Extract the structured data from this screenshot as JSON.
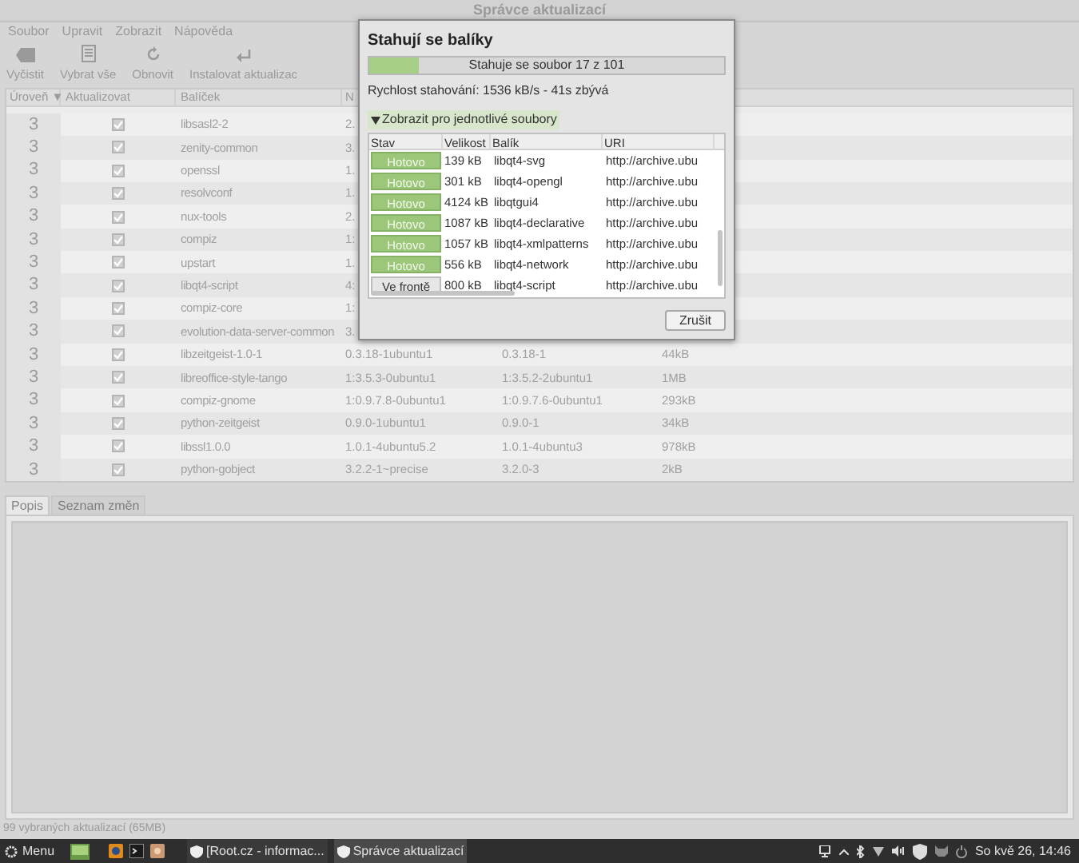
{
  "window": {
    "title": "Správce aktualizací"
  },
  "menu": [
    "Soubor",
    "Upravit",
    "Zobrazit",
    "Nápověda"
  ],
  "toolbar": [
    {
      "label": "Vyčistit",
      "kind": "clear"
    },
    {
      "label": "Vybrat vše",
      "kind": "select"
    },
    {
      "label": "Obnovit",
      "kind": "refresh"
    },
    {
      "label": "Instalovat aktualizac",
      "kind": "install"
    }
  ],
  "table": {
    "columns": [
      "Úroveň ▼",
      "Aktualizovat",
      "Balíček",
      "N"
    ],
    "rows": [
      {
        "level": "3",
        "checked": true,
        "package": "libsasl2-2",
        "new": "2."
      },
      {
        "level": "3",
        "checked": true,
        "package": "zenity-common",
        "new": "3."
      },
      {
        "level": "3",
        "checked": true,
        "package": "openssl",
        "new": "1."
      },
      {
        "level": "3",
        "checked": true,
        "package": "resolvconf",
        "new": "1."
      },
      {
        "level": "3",
        "checked": true,
        "package": "nux-tools",
        "new": "2."
      },
      {
        "level": "3",
        "checked": true,
        "package": "compiz",
        "new": "1:"
      },
      {
        "level": "3",
        "checked": true,
        "package": "upstart",
        "new": "1."
      },
      {
        "level": "3",
        "checked": true,
        "package": "libqt4-script",
        "new": "4:"
      },
      {
        "level": "3",
        "checked": true,
        "package": "compiz-core",
        "new": "1:"
      },
      {
        "level": "3",
        "checked": true,
        "package": "evolution-data-server-common",
        "new": "3."
      },
      {
        "level": "3",
        "checked": true,
        "package": "libzeitgeist-1.0-1",
        "new": "0.3.18-1ubuntu1",
        "old": "0.3.18-1",
        "size": "44kB"
      },
      {
        "level": "3",
        "checked": true,
        "package": "libreoffice-style-tango",
        "new": "1:3.5.3-0ubuntu1",
        "old": "1:3.5.2-2ubuntu1",
        "size": "1MB"
      },
      {
        "level": "3",
        "checked": true,
        "package": "compiz-gnome",
        "new": "1:0.9.7.8-0ubuntu1",
        "old": "1:0.9.7.6-0ubuntu1",
        "size": "293kB"
      },
      {
        "level": "3",
        "checked": true,
        "package": "python-zeitgeist",
        "new": "0.9.0-1ubuntu1",
        "old": "0.9.0-1",
        "size": "34kB"
      },
      {
        "level": "3",
        "checked": true,
        "package": "libssl1.0.0",
        "new": "1.0.1-4ubuntu5.2",
        "old": "1.0.1-4ubuntu3",
        "size": "978kB"
      },
      {
        "level": "3",
        "checked": true,
        "package": "python-gobject",
        "new": "3.2.2-1~precise",
        "old": "3.2.0-3",
        "size": "2kB"
      }
    ]
  },
  "dialog": {
    "title": "Stahují se balíky",
    "progress": {
      "label": "Stahuje se soubor 17 z 101",
      "level": 0.14
    },
    "speed": "Rychlost stahování: 1536 kB/s - 41s zbývá",
    "expander": {
      "label": "Zobrazit pro jednotlivé soubory",
      "expanded": true
    },
    "columns": [
      "Stav",
      "Velikost",
      "Balík",
      "URI"
    ],
    "files": [
      {
        "status": "Hotovo",
        "kind": "done",
        "size": "139 kB",
        "package": "libqt4-svg",
        "uri": "http://archive.ubu"
      },
      {
        "status": "Hotovo",
        "kind": "done",
        "size": "301 kB",
        "package": "libqt4-opengl",
        "uri": "http://archive.ubu"
      },
      {
        "status": "Hotovo",
        "kind": "done",
        "size": "4124 kB",
        "package": "libqtgui4",
        "uri": "http://archive.ubu"
      },
      {
        "status": "Hotovo",
        "kind": "done",
        "size": "1087 kB",
        "package": "libqt4-declarative",
        "uri": "http://archive.ubu"
      },
      {
        "status": "Hotovo",
        "kind": "done",
        "size": "1057 kB",
        "package": "libqt4-xmlpatterns",
        "uri": "http://archive.ubu"
      },
      {
        "status": "Hotovo",
        "kind": "done",
        "size": "556 kB",
        "package": "libqt4-network",
        "uri": "http://archive.ubu"
      },
      {
        "status": "Ve frontě",
        "kind": "queued",
        "size": "800 kB",
        "package": "libqt4-script",
        "uri": "http://archive.ubu"
      }
    ],
    "button": "Zrušit"
  },
  "tabs": [
    {
      "label": "Popis",
      "selected": true
    },
    {
      "label": "Seznam změn",
      "selected": false
    }
  ],
  "status_bar": "99 vybraných aktualizací (65MB)",
  "taskbar": {
    "menu": "Menu",
    "windows": [
      {
        "label": "[Root.cz - informac...",
        "selected": false
      },
      {
        "label": "Správce aktualizací",
        "selected": true
      }
    ],
    "clock": "So kvě 26, 14:46"
  }
}
